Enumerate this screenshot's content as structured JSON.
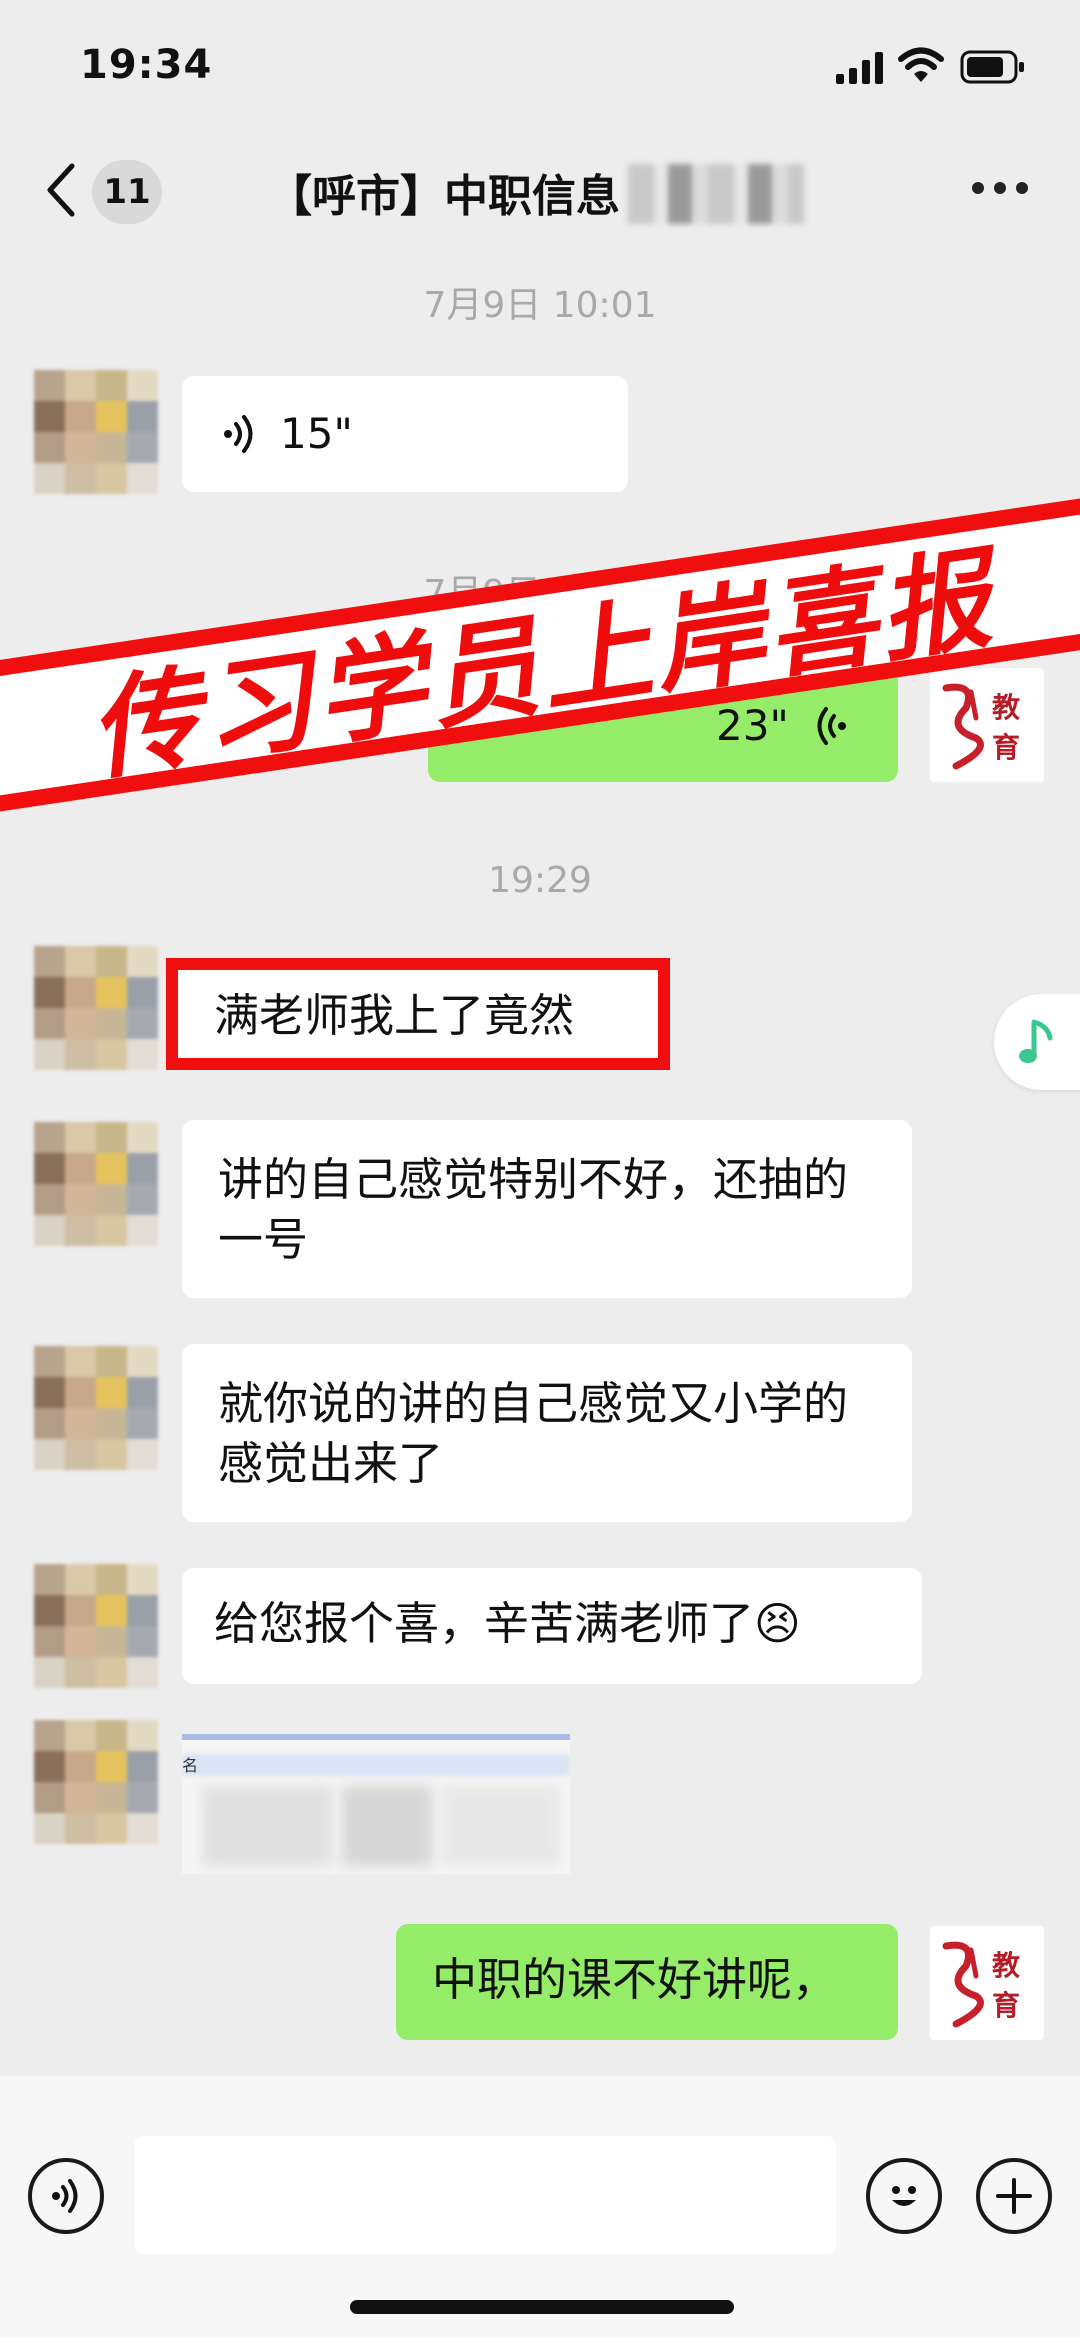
{
  "status_bar": {
    "time": "19:34"
  },
  "nav": {
    "unread_count": "11",
    "title": "【呼市】中职信息"
  },
  "timestamps": [
    "7月9日 10:01",
    "7月9日 10:56",
    "19:29"
  ],
  "stamp_text": "传习学员上岸喜报",
  "logo_text": "教育",
  "messages": [
    {
      "side": "left",
      "type": "voice",
      "duration": "15\""
    },
    {
      "side": "right",
      "type": "voice",
      "duration": "23\""
    },
    {
      "side": "left",
      "type": "text",
      "text": "满老师我上了竟然",
      "highlighted": true
    },
    {
      "side": "left",
      "type": "text",
      "text": "讲的自己感觉特别不好，还抽的一号"
    },
    {
      "side": "left",
      "type": "text",
      "text": "就你说的讲的自己感觉又小学的感觉出来了"
    },
    {
      "side": "left",
      "type": "text",
      "text": "给您报个喜，辛苦满老师了😣"
    },
    {
      "side": "left",
      "type": "image",
      "caption": "名"
    },
    {
      "side": "right",
      "type": "text",
      "text": "中职的课不好讲呢，"
    }
  ],
  "colors": {
    "background": "#ededed",
    "bubble_green": "#95ec69",
    "stamp_red": "#f00e0e",
    "music_green": "#3cc78f"
  },
  "icons": [
    "back-icon",
    "more-icon",
    "voice-wave-icon",
    "keyboard-voice-icon",
    "emoji-icon",
    "plus-icon",
    "music-note-icon"
  ]
}
